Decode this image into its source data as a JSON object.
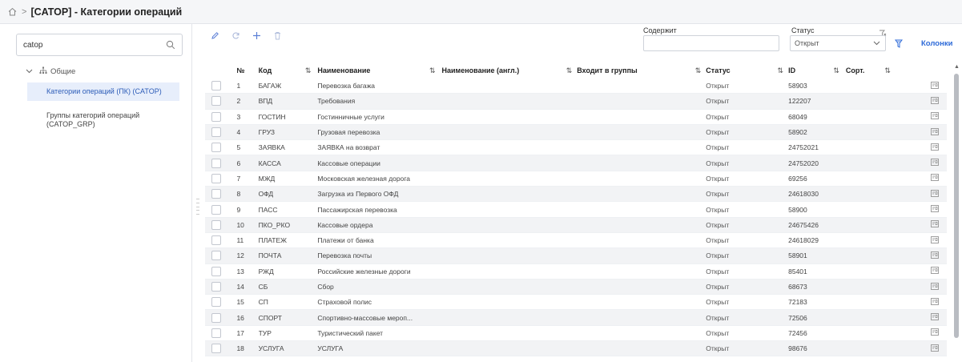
{
  "breadcrumb": {
    "home_icon": "home-icon",
    "separator": ">",
    "title": "[CATOP] - Категории операций"
  },
  "sidebar": {
    "search": {
      "value": "catop",
      "placeholder": ""
    },
    "root": {
      "label": "Общие"
    },
    "items": [
      {
        "label": "Категории операций (ПК) (CATOP)",
        "active": true
      },
      {
        "label_line1": "Группы категорий операций",
        "label_line2": "(CATOP_GRP)",
        "active": false
      }
    ]
  },
  "filters": {
    "contains_label": "Содержит",
    "contains_value": "",
    "status_label": "Статус",
    "status_value": "Открыт",
    "columns_label": "Колонки"
  },
  "table": {
    "headers": {
      "num": "№",
      "code": "Код",
      "name": "Наименование",
      "name_en": "Наименование (англ.)",
      "groups": "Входит в группы",
      "status": "Статус",
      "id": "ID",
      "sort": "Сорт."
    },
    "sort_icon": "⇅",
    "rows": [
      {
        "num": "1",
        "code": "БАГАЖ",
        "name": "Перевозка багажа",
        "status": "Открыт",
        "id": "58903"
      },
      {
        "num": "2",
        "code": "ВПД",
        "name": "Требования",
        "status": "Открыт",
        "id": "122207"
      },
      {
        "num": "3",
        "code": "ГОСТИН",
        "name": "Гостинничные услуги",
        "status": "Открыт",
        "id": "68049"
      },
      {
        "num": "4",
        "code": "ГРУЗ",
        "name": "Грузовая перевозка",
        "status": "Открыт",
        "id": "58902"
      },
      {
        "num": "5",
        "code": "ЗАЯВКА",
        "name": "ЗАЯВКА на возврат",
        "status": "Открыт",
        "id": "24752021"
      },
      {
        "num": "6",
        "code": "КАССА",
        "name": "Кассовые операции",
        "status": "Открыт",
        "id": "24752020"
      },
      {
        "num": "7",
        "code": "МЖД",
        "name": "Московская железная дорога",
        "status": "Открыт",
        "id": "69256"
      },
      {
        "num": "8",
        "code": "ОФД",
        "name": "Загрузка из Первого ОФД",
        "status": "Открыт",
        "id": "24618030"
      },
      {
        "num": "9",
        "code": "ПАСС",
        "name": "Пассажирская перевозка",
        "status": "Открыт",
        "id": "58900"
      },
      {
        "num": "10",
        "code": "ПКО_РКО",
        "name": "Кассовые ордера",
        "status": "Открыт",
        "id": "24675426"
      },
      {
        "num": "11",
        "code": "ПЛАТЕЖ",
        "name": "Платежи от банка",
        "status": "Открыт",
        "id": "24618029"
      },
      {
        "num": "12",
        "code": "ПОЧТА",
        "name": "Перевозка почты",
        "status": "Открыт",
        "id": "58901"
      },
      {
        "num": "13",
        "code": "РЖД",
        "name": "Российские железные дороги",
        "status": "Открыт",
        "id": "85401"
      },
      {
        "num": "14",
        "code": "СБ",
        "name": "Сбор",
        "status": "Открыт",
        "id": "68673"
      },
      {
        "num": "15",
        "code": "СП",
        "name": "Страховой полис",
        "status": "Открыт",
        "id": "72183"
      },
      {
        "num": "16",
        "code": "СПОРТ",
        "name": "Спортивно-массовые мероп...",
        "status": "Открыт",
        "id": "72506"
      },
      {
        "num": "17",
        "code": "ТУР",
        "name": "Туристический пакет",
        "status": "Открыт",
        "id": "72456"
      },
      {
        "num": "18",
        "code": "УСЛУГА",
        "name": "УСЛУГА",
        "status": "Открыт",
        "id": "98676"
      }
    ]
  },
  "colors": {
    "accent": "#2d6ad8",
    "active_bg": "#e7eefb",
    "row_alt": "#f2f3f5"
  }
}
